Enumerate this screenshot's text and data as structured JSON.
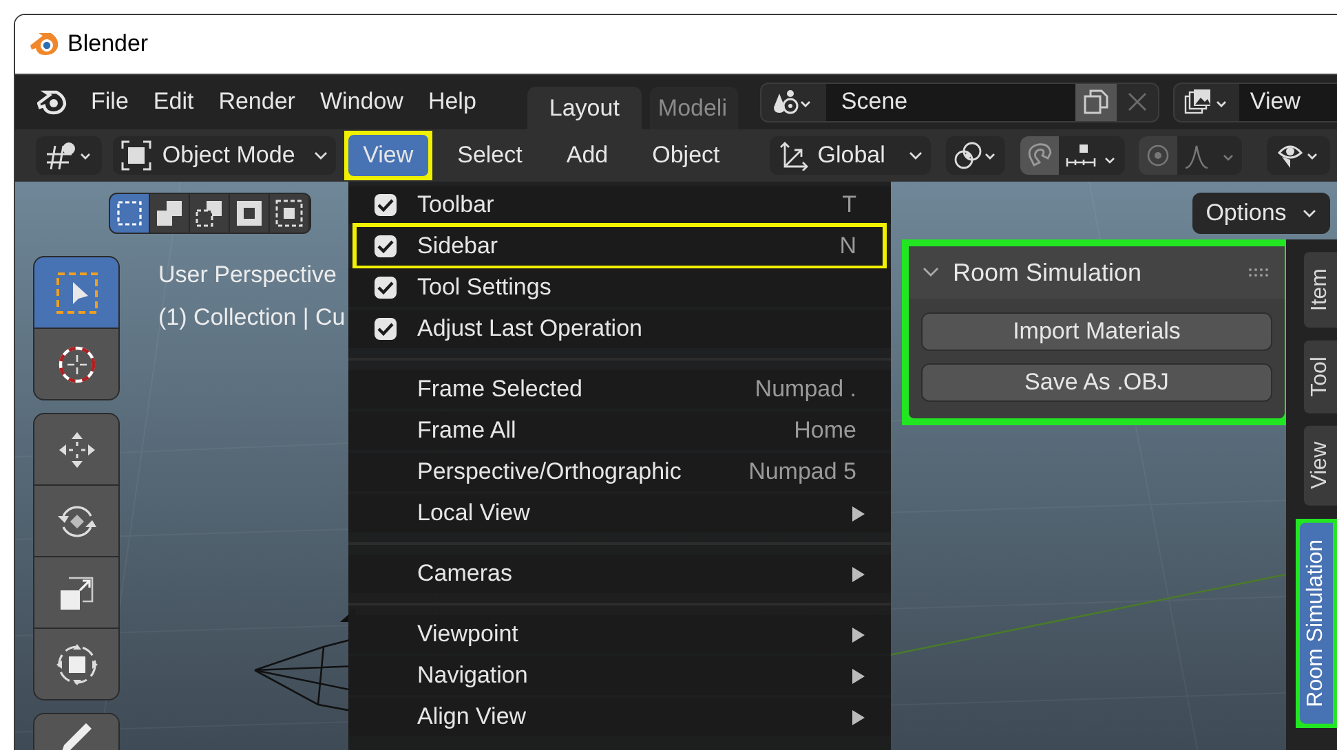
{
  "window": {
    "title": "Blender"
  },
  "menu_bar": {
    "items": [
      "File",
      "Edit",
      "Render",
      "Window",
      "Help"
    ]
  },
  "workspace_tabs": [
    {
      "label": "Layout",
      "selected": true
    },
    {
      "label": "Modeli",
      "selected": false
    }
  ],
  "scene": {
    "value": "Scene"
  },
  "view_layer": {
    "value": "View"
  },
  "header": {
    "mode": "Object Mode",
    "orientation": "Global",
    "snap": {
      "on": false
    },
    "proportional_edit": {
      "on": false
    },
    "menus": [
      {
        "label": "View",
        "selected": true,
        "highlighted": true
      },
      {
        "label": "Select",
        "selected": false
      },
      {
        "label": "Add",
        "selected": false
      },
      {
        "label": "Object",
        "selected": false
      }
    ]
  },
  "select_modes": [
    {
      "selected": true
    },
    {
      "selected": false
    },
    {
      "selected": false
    },
    {
      "selected": false
    },
    {
      "selected": false
    }
  ],
  "tool_groups": [
    {
      "tools": [
        {
          "kind": "select",
          "selected": true
        },
        {
          "kind": "cursor",
          "selected": false
        }
      ]
    },
    {
      "tools": [
        {
          "kind": "move",
          "selected": false
        },
        {
          "kind": "rotate",
          "selected": false
        },
        {
          "kind": "scale",
          "selected": false
        },
        {
          "kind": "transform",
          "selected": false
        }
      ]
    },
    {
      "tools": [
        {
          "kind": "annotate",
          "selected": false
        }
      ]
    }
  ],
  "viewport": {
    "overlay": [
      "User Perspective",
      "(1) Collection | Cu"
    ]
  },
  "view_menu": {
    "items": [
      {
        "kind": "check",
        "label": "Toolbar",
        "checked": true,
        "shortcut": "T"
      },
      {
        "kind": "check",
        "label": "Sidebar",
        "checked": true,
        "shortcut": "N",
        "highlighted": true
      },
      {
        "kind": "check",
        "label": "Tool Settings",
        "checked": true
      },
      {
        "kind": "check",
        "label": "Adjust Last Operation",
        "checked": true
      },
      {
        "kind": "separator"
      },
      {
        "kind": "command",
        "label": "Frame Selected",
        "shortcut": "Numpad ."
      },
      {
        "kind": "command",
        "label": "Frame All",
        "shortcut": "Home"
      },
      {
        "kind": "command",
        "label": "Perspective/Orthographic",
        "shortcut": "Numpad 5"
      },
      {
        "kind": "submenu",
        "label": "Local View"
      },
      {
        "kind": "separator"
      },
      {
        "kind": "submenu",
        "label": "Cameras"
      },
      {
        "kind": "separator"
      },
      {
        "kind": "submenu",
        "label": "Viewpoint"
      },
      {
        "kind": "submenu",
        "label": "Navigation"
      },
      {
        "kind": "submenu",
        "label": "Align View"
      }
    ]
  },
  "options_button": {
    "label": "Options"
  },
  "sidebar_panel": {
    "title": "Room Simulation",
    "expanded": true,
    "highlighted": true,
    "buttons": [
      "Import Materials",
      "Save As .OBJ"
    ]
  },
  "sidebar_tabs": [
    {
      "label": "Item",
      "selected": false
    },
    {
      "label": "Tool",
      "selected": false
    },
    {
      "label": "View",
      "selected": false
    },
    {
      "label": "Room Simulation",
      "selected": true,
      "highlighted": true
    }
  ]
}
